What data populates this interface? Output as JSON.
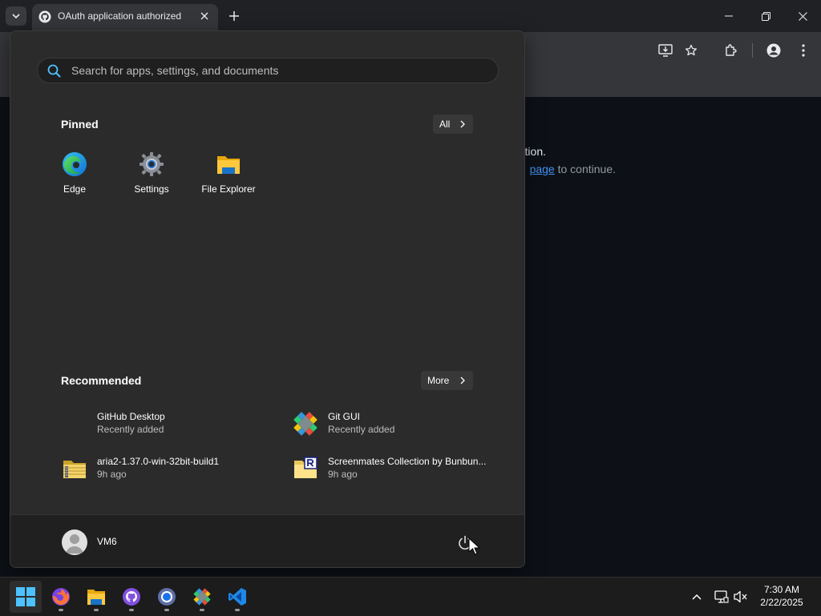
{
  "browser": {
    "tab_title": "OAuth application authorized",
    "icons": {
      "tab_search": "chevron-down-icon",
      "favicon": "github-icon",
      "tab_close": "close-icon",
      "new_tab": "plus-icon",
      "minimize": "minimize-icon",
      "restore": "restore-icon",
      "close": "close-icon",
      "install_app": "install-app-icon",
      "bookmark": "star-icon",
      "extensions": "puzzle-icon",
      "profile": "profile-icon",
      "menu": "kebab-menu-icon"
    }
  },
  "page": {
    "line1": "tion.",
    "line2_link": "page",
    "line2_rest": " to continue."
  },
  "start_menu": {
    "search_placeholder": "Search for apps, settings, and documents",
    "pinned_title": "Pinned",
    "all_button": "All",
    "pinned": [
      {
        "label": "Edge",
        "icon": "edge-icon"
      },
      {
        "label": "Settings",
        "icon": "settings-gear-icon"
      },
      {
        "label": "File Explorer",
        "icon": "folder-icon"
      }
    ],
    "recommended_title": "Recommended",
    "more_button": "More",
    "recommended": [
      {
        "name": "GitHub Desktop",
        "sub": "Recently added",
        "icon": "github-desktop-icon"
      },
      {
        "name": "Git GUI",
        "sub": "Recently added",
        "icon": "git-gui-icon"
      },
      {
        "name": "aria2-1.37.0-win-32bit-build1",
        "sub": "9h ago",
        "icon": "zip-folder-icon"
      },
      {
        "name": "Screenmates Collection by Bunbun...",
        "sub": "9h ago",
        "icon": "folder-r-icon"
      }
    ],
    "user_name": "VM6",
    "power_icon": "power-icon"
  },
  "taskbar": {
    "apps": [
      "start-icon",
      "firefox-icon",
      "file-explorer-icon",
      "github-desktop-icon",
      "chrome-icon",
      "git-gui-icon",
      "vscode-icon"
    ],
    "tray": [
      "chevron-up-icon",
      "network-icon",
      "volume-muted-icon"
    ],
    "time": "7:30 AM",
    "date": "2/22/2025"
  },
  "colors": {
    "page_bg": "#0d1117",
    "menu_bg": "#2b2b2b",
    "taskbar_bg": "#1c1c1c",
    "link": "#4493f8",
    "accent_blue": "#0078d4"
  }
}
